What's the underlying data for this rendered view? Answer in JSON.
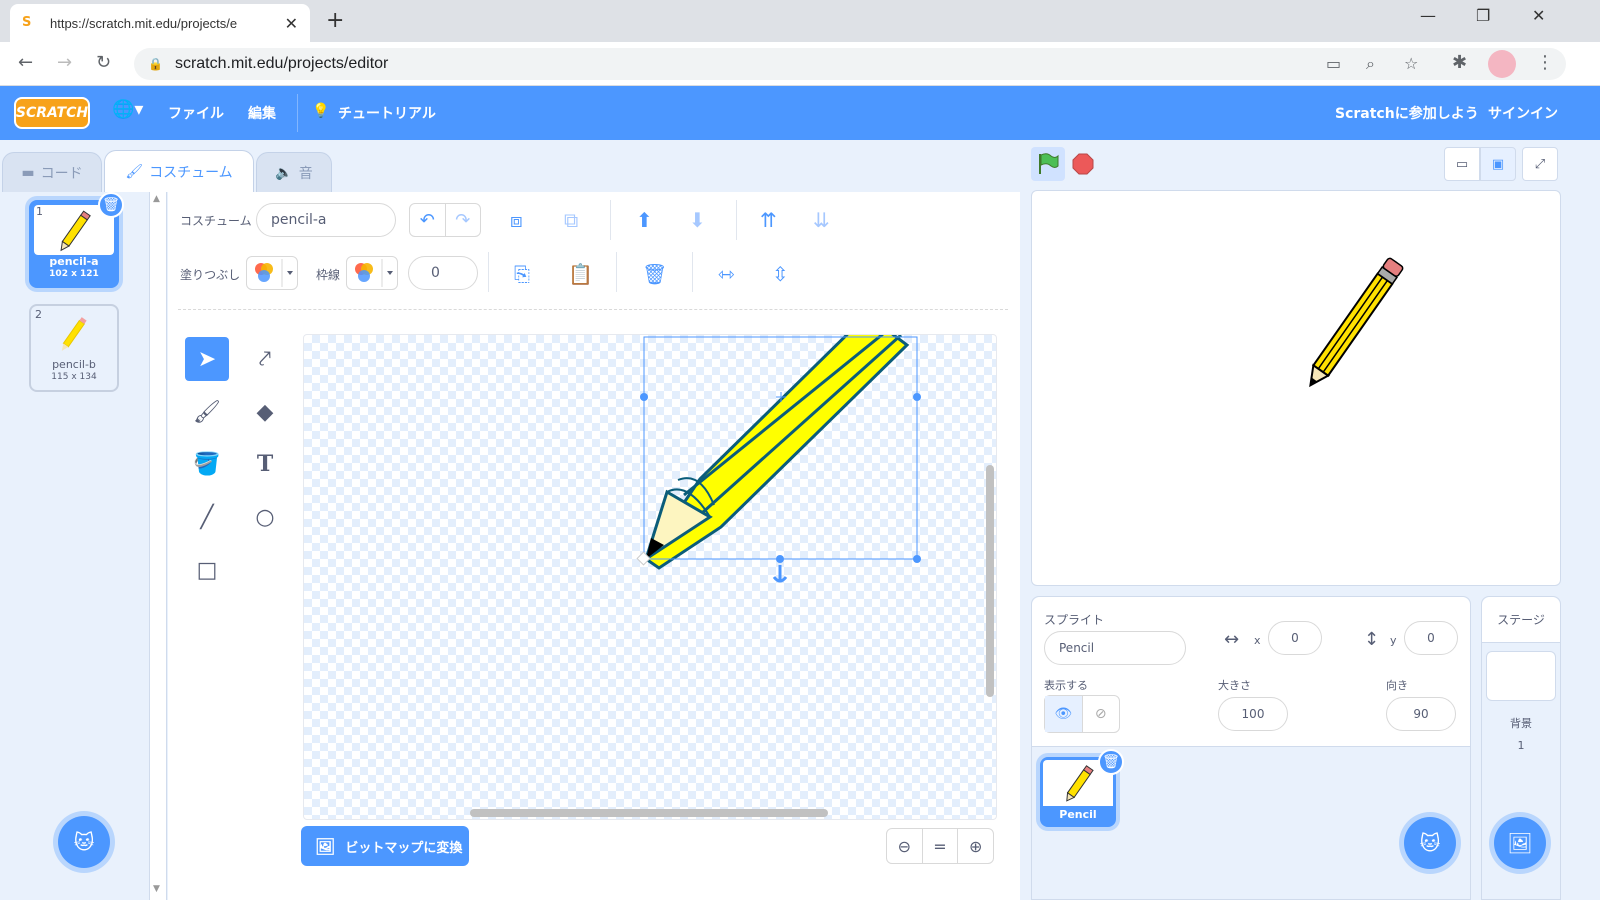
{
  "browser": {
    "tab_title": "https://scratch.mit.edu/projects/e",
    "url": "scratch.mit.edu/projects/editor",
    "favicon": "S"
  },
  "menubar": {
    "logo": "SCRATCH",
    "file": "ファイル",
    "edit": "編集",
    "tutorial": "チュートリアル",
    "join": "Scratchに参加しよう",
    "signin": "サインイン"
  },
  "tabs": {
    "code": "コード",
    "costumes": "コスチューム",
    "sounds": "音"
  },
  "costumes": [
    {
      "num": "1",
      "name": "pencil-a",
      "size": "102 x 121"
    },
    {
      "num": "2",
      "name": "pencil-b",
      "size": "115 x 134"
    }
  ],
  "paint": {
    "costume_label": "コスチューム",
    "costume_name": "pencil-a",
    "fill_label": "塗りつぶし",
    "outline_label": "枠線",
    "outline_width": "0",
    "bitmap_button": "ビットマップに変換"
  },
  "sprite": {
    "label": "スプライト",
    "name": "Pencil",
    "x_label": "x",
    "x": "0",
    "y_label": "y",
    "y": "0",
    "show_label": "表示する",
    "size_label": "大きさ",
    "size": "100",
    "direction_label": "向き",
    "direction": "90",
    "tile_name": "Pencil"
  },
  "stage_panel": {
    "title": "ステージ",
    "backdrops_label": "背景",
    "backdrops_count": "1"
  },
  "colors": {
    "accent": "#4c97ff",
    "pencil_yellow": "#ffff00",
    "pencil_outline": "#0b5d7a"
  }
}
